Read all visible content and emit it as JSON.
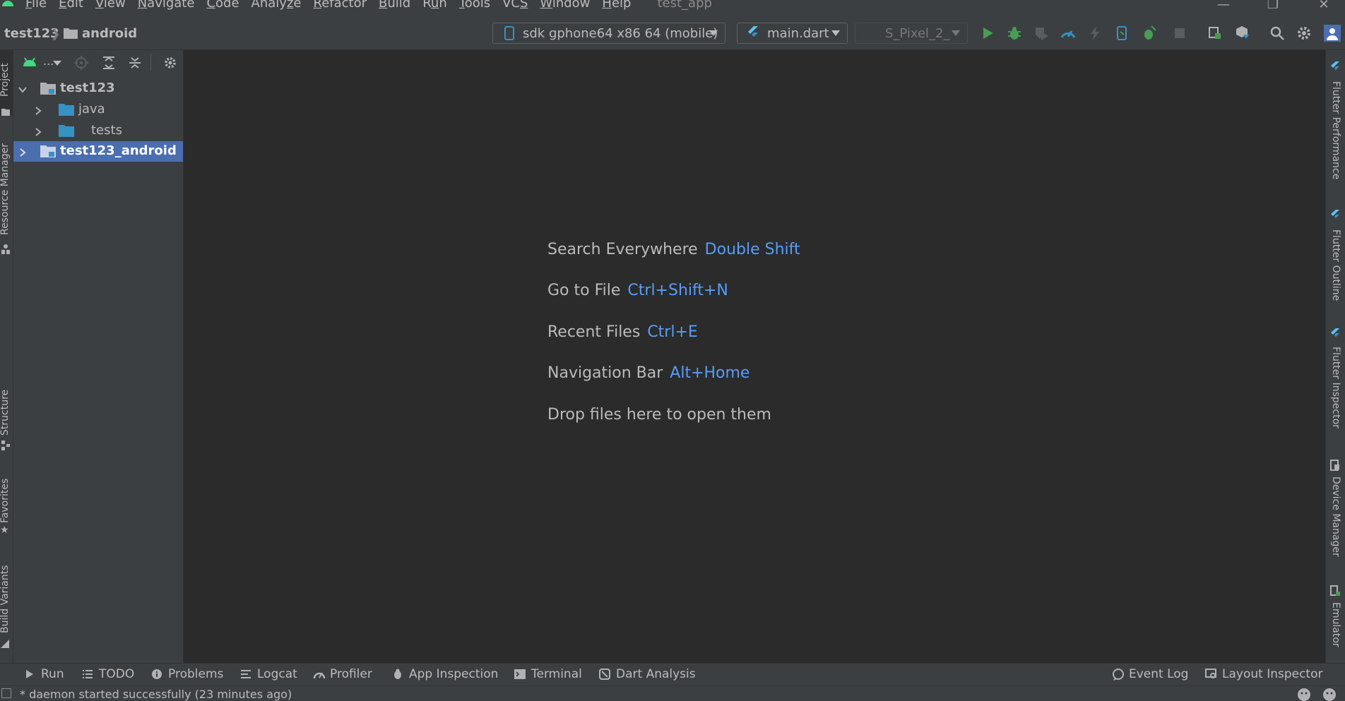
{
  "menubar": {
    "items": [
      "File",
      "Edit",
      "View",
      "Navigate",
      "Code",
      "Analyze",
      "Refactor",
      "Build",
      "Run",
      "Tools",
      "VCS",
      "Window",
      "Help"
    ],
    "mnemonics": [
      0,
      0,
      0,
      0,
      0,
      5,
      0,
      0,
      1,
      0,
      2,
      0,
      0
    ],
    "app_title": "test_app",
    "window_controls": [
      "minimize-icon",
      "restore-icon",
      "close-icon"
    ]
  },
  "breadcrumb": {
    "project": "test123",
    "module": "android"
  },
  "toolbar": {
    "device_selector": "sdk gphone64 x86 64 (mobile)",
    "run_config": "main.dart",
    "emulator_selector": "S_Pixel_2_",
    "icons": [
      "run-icon",
      "debug-icon",
      "coverage-icon",
      "profile-icon",
      "hot-reload-icon",
      "attach-debugger-icon",
      "apply-changes-icon",
      "stop-icon",
      "device-manager-icon",
      "sdk-manager-icon",
      "search-icon",
      "settings-icon",
      "account-icon"
    ]
  },
  "left_tabs": [
    "Project",
    "Resource Manager",
    "Structure",
    "Favorites",
    "Build Variants"
  ],
  "project_tree": [
    {
      "label": "test123",
      "depth": 0,
      "expanded": true,
      "selected": false
    },
    {
      "label": "java",
      "depth": 1,
      "expanded": false,
      "selected": false
    },
    {
      "label": "tests",
      "depth": 1,
      "expanded": false,
      "selected": false
    },
    {
      "label": "test123_android",
      "depth": 0,
      "expanded": false,
      "selected": true
    }
  ],
  "project_toolbar": {
    "view_label": "..."
  },
  "editor_hints": [
    {
      "text": "Search Everywhere",
      "key": "Double Shift"
    },
    {
      "text": "Go to File",
      "key": "Ctrl+Shift+N"
    },
    {
      "text": "Recent Files",
      "key": "Ctrl+E"
    },
    {
      "text": "Navigation Bar",
      "key": "Alt+Home"
    },
    {
      "text": "Drop files here to open them",
      "key": ""
    }
  ],
  "right_tabs": [
    "Flutter Performance",
    "Flutter Outline",
    "Flutter Inspector",
    "Device Manager",
    "Emulator"
  ],
  "bottom_tabs": [
    "Run",
    "TODO",
    "Problems",
    "Logcat",
    "Profiler",
    "App Inspection",
    "Terminal",
    "Dart Analysis"
  ],
  "bottom_right_tabs": [
    "Event Log",
    "Layout Inspector"
  ],
  "status": {
    "message": "* daemon started successfully (23 minutes ago)"
  },
  "colors": {
    "accent": "#589df6",
    "selection": "#4b6eaf",
    "run_green": "#499c54",
    "flutter_blue": "#3592c4"
  }
}
